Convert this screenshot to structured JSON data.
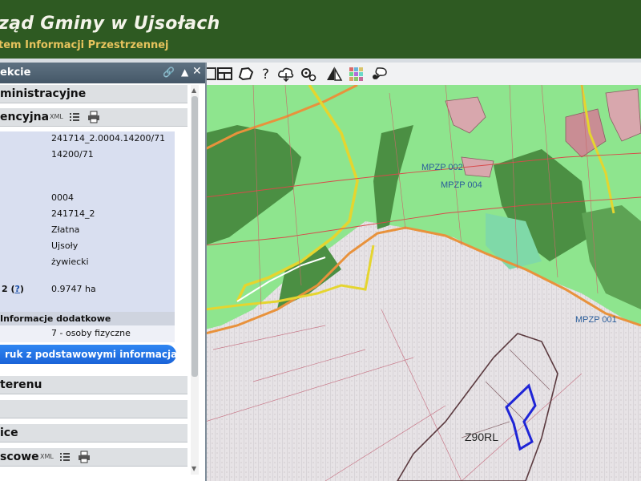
{
  "header": {
    "title": "ząd Gminy w Ujsołach",
    "subtitle": "tem Informacji Przestrzennej"
  },
  "panel": {
    "title": "ekcie",
    "sections": {
      "administracyjne": "ministracyjne",
      "ewidencyjna": "encyjna",
      "terenu": "terenu",
      "s4": "",
      "ice": "ice",
      "scowe": "scowe"
    },
    "xml_label": "XML",
    "props": {
      "id": "241714_2.0004.14200/71",
      "number": "14200/71",
      "obreb": "0004",
      "jednostka": "241714_2",
      "obreb_nazwa": "Złatna",
      "gmina": "Ujsoły",
      "powiat": "żywiecki",
      "area_key": "2",
      "area_help": "?",
      "area_value": "0.9747 ha"
    },
    "additional_info_label": "Informacje dodatkowe",
    "additional_info_value": "7 - osoby fizyczne",
    "print_button": "ruk z podstawowymi informacjami"
  },
  "map": {
    "labels": {
      "mpzp002": "MPZP 002",
      "mpzp004": "MPZP 004",
      "mpzp001": "MPZP 001",
      "z90": "Z90RL"
    }
  },
  "colors": {
    "header": "#2e5a22",
    "subtitle": "#e7c35d",
    "map_light_green": "#8ee58e",
    "map_dark_green": "#4b8f43",
    "map_forest_gray": "#e7e3e6",
    "selected_parcel": "#1f25d6",
    "button_blue": "#1a63d8"
  }
}
